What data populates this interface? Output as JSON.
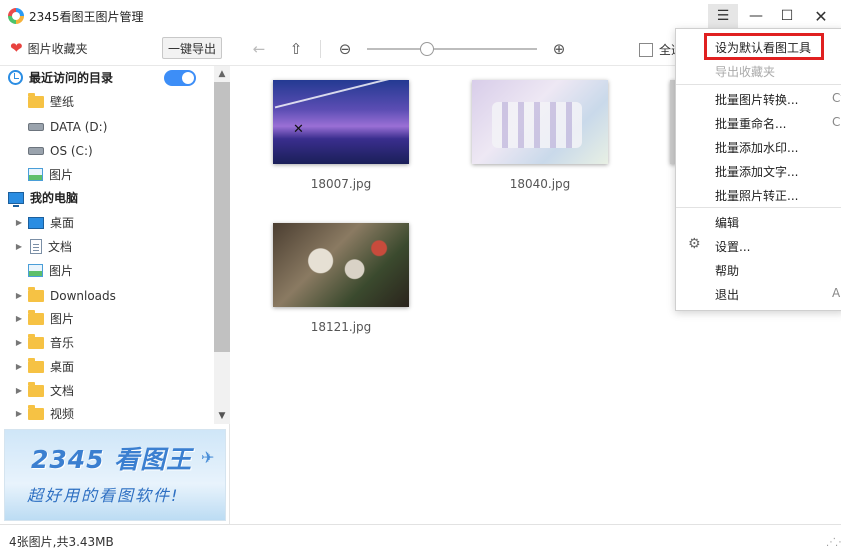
{
  "window": {
    "title": "2345看图王图片管理",
    "menu_glyph": "☰",
    "min_glyph": "—",
    "max_glyph": "☐",
    "close_glyph": "✕"
  },
  "toolbar": {
    "favorites_label": "图片收藏夹",
    "export_label": "一键导出",
    "select_all_label": "全选",
    "back_glyph": "←",
    "up_glyph": "⇧",
    "zoom_out_glyph": "⊖",
    "zoom_in_glyph": "⊕",
    "zoom_level": 0.35
  },
  "sidebar": {
    "recent_header": "最近访问的目录",
    "recent_toggle_on": true,
    "recent_items": [
      {
        "label": "壁纸",
        "icon": "folder-icon"
      },
      {
        "label": "DATA (D:)",
        "icon": "drive-icon"
      },
      {
        "label": "OS (C:)",
        "icon": "drive-icon"
      },
      {
        "label": "图片",
        "icon": "image-icon"
      }
    ],
    "pc_header": "我的电脑",
    "pc_items": [
      {
        "label": "桌面",
        "icon": "desktop-icon"
      },
      {
        "label": "文档",
        "icon": "doc-icon"
      },
      {
        "label": "图片",
        "icon": "image-icon"
      },
      {
        "label": "Downloads",
        "icon": "folder-icon"
      },
      {
        "label": "图片",
        "icon": "folder-icon"
      },
      {
        "label": "音乐",
        "icon": "folder-icon"
      },
      {
        "label": "桌面",
        "icon": "folder-icon"
      },
      {
        "label": "文档",
        "icon": "folder-icon"
      },
      {
        "label": "视频",
        "icon": "folder-icon"
      }
    ]
  },
  "ad": {
    "title": "2345 看图王",
    "slogan": "超好用的看图软件!"
  },
  "thumbnails": [
    {
      "name": "18007.jpg"
    },
    {
      "name": "18040.jpg"
    },
    {
      "name": "18121.jpg"
    }
  ],
  "status": {
    "summary": "4张图片,共3.43MB"
  },
  "menu": {
    "items": [
      {
        "label": "设为默认看图工具",
        "shortcut": "",
        "disabled": false,
        "highlighted": true
      },
      {
        "label": "导出收藏夹",
        "shortcut": "",
        "disabled": true
      },
      {
        "label": "批量图片转换...",
        "shortcut": "Ct",
        "disabled": false
      },
      {
        "label": "批量重命名...",
        "shortcut": "C",
        "disabled": false
      },
      {
        "label": "批量添加水印...",
        "shortcut": "",
        "disabled": false
      },
      {
        "label": "批量添加文字...",
        "shortcut": "",
        "disabled": false
      },
      {
        "label": "批量照片转正...",
        "shortcut": "",
        "disabled": false
      },
      {
        "label": "编辑",
        "shortcut": "",
        "disabled": false
      },
      {
        "label": "设置...",
        "shortcut": "",
        "disabled": false,
        "icon": "gear-icon"
      },
      {
        "label": "帮助",
        "shortcut": "",
        "disabled": false
      },
      {
        "label": "退出",
        "shortcut": "A",
        "disabled": false
      }
    ],
    "highlight_color": "#e02020"
  },
  "colors": {
    "accent": "#3d8ef7",
    "heart": "#e8433f",
    "folder": "#f6c244"
  }
}
